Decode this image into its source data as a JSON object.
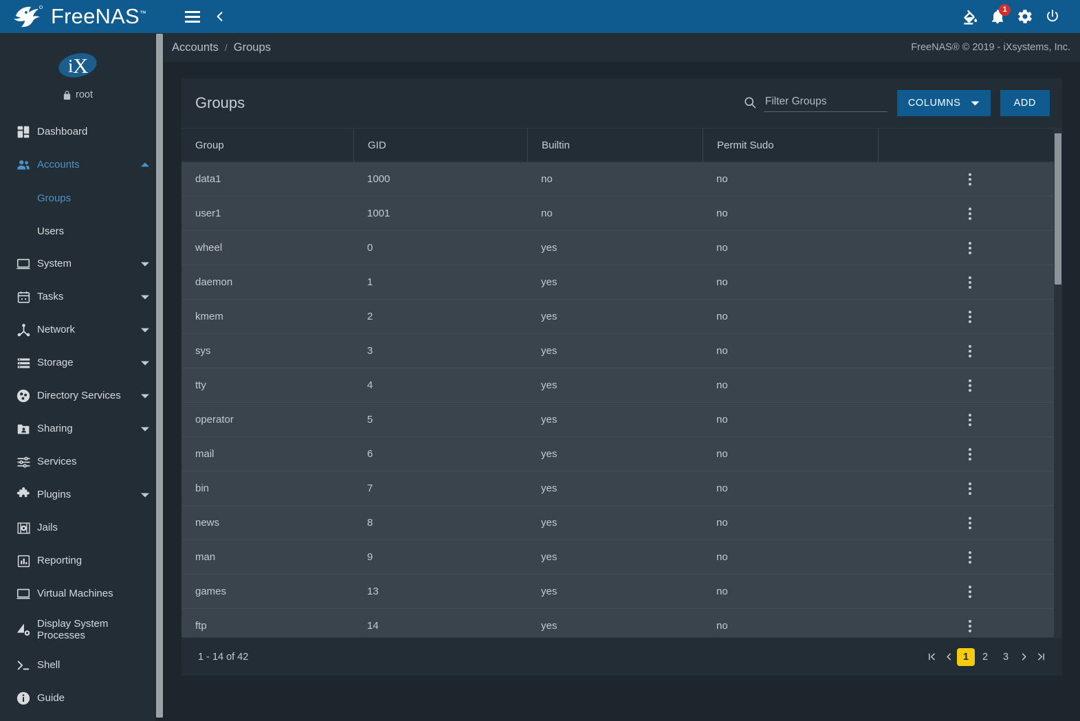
{
  "topbar": {
    "brand": "FreeNAS",
    "brand_tm": "™",
    "menu_icon": "hamburger-icon",
    "back_icon": "chevron-left-icon",
    "theme_icon": "paint-bucket-icon",
    "notifications_icon": "bell-icon",
    "notifications_count": "1",
    "settings_icon": "gear-icon",
    "power_icon": "power-icon"
  },
  "sidebar": {
    "logo": "ix-logo",
    "logo_text": "iX",
    "user": "root",
    "user_icon": "lock-icon",
    "items": [
      {
        "label": "Dashboard",
        "icon": "dashboard-icon",
        "expandable": false,
        "active": false
      },
      {
        "label": "Accounts",
        "icon": "accounts-icon",
        "expandable": true,
        "expanded": true,
        "active": true
      },
      {
        "label": "System",
        "icon": "system-icon",
        "expandable": true,
        "active": false
      },
      {
        "label": "Tasks",
        "icon": "tasks-icon",
        "expandable": true,
        "active": false
      },
      {
        "label": "Network",
        "icon": "network-icon",
        "expandable": true,
        "active": false
      },
      {
        "label": "Storage",
        "icon": "storage-icon",
        "expandable": true,
        "active": false
      },
      {
        "label": "Directory Services",
        "icon": "directory-services-icon",
        "expandable": true,
        "active": false
      },
      {
        "label": "Sharing",
        "icon": "sharing-icon",
        "expandable": true,
        "active": false
      },
      {
        "label": "Services",
        "icon": "services-icon",
        "expandable": false,
        "active": false
      },
      {
        "label": "Plugins",
        "icon": "plugins-icon",
        "expandable": true,
        "active": false
      },
      {
        "label": "Jails",
        "icon": "jails-icon",
        "expandable": false,
        "active": false
      },
      {
        "label": "Reporting",
        "icon": "reporting-icon",
        "expandable": false,
        "active": false
      },
      {
        "label": "Virtual Machines",
        "icon": "virtual-machines-icon",
        "expandable": false,
        "active": false
      },
      {
        "label": "Display System Processes",
        "icon": "display-system-processes-icon",
        "expandable": false,
        "active": false
      },
      {
        "label": "Shell",
        "icon": "shell-icon",
        "expandable": false,
        "active": false
      },
      {
        "label": "Guide",
        "icon": "guide-icon",
        "expandable": false,
        "active": false
      }
    ],
    "subitems": [
      {
        "label": "Groups",
        "active": true
      },
      {
        "label": "Users",
        "active": false
      }
    ]
  },
  "breadcrumb": {
    "parent": "Accounts",
    "separator": "/",
    "current": "Groups",
    "copyright": "FreeNAS® © 2019 - iXsystems, Inc."
  },
  "card": {
    "title": "Groups",
    "search_placeholder": "Filter Groups",
    "search_value": "",
    "search_icon": "search-icon",
    "columns_button": "COLUMNS",
    "columns_caret_icon": "chevron-down-icon",
    "add_button": "ADD",
    "actions_icon": "kebab-menu-icon"
  },
  "table": {
    "headers": [
      "Group",
      "GID",
      "Builtin",
      "Permit Sudo",
      ""
    ],
    "rows": [
      {
        "group": "data1",
        "gid": "1000",
        "builtin": "no",
        "permit_sudo": "no"
      },
      {
        "group": "user1",
        "gid": "1001",
        "builtin": "no",
        "permit_sudo": "no"
      },
      {
        "group": "wheel",
        "gid": "0",
        "builtin": "yes",
        "permit_sudo": "no"
      },
      {
        "group": "daemon",
        "gid": "1",
        "builtin": "yes",
        "permit_sudo": "no"
      },
      {
        "group": "kmem",
        "gid": "2",
        "builtin": "yes",
        "permit_sudo": "no"
      },
      {
        "group": "sys",
        "gid": "3",
        "builtin": "yes",
        "permit_sudo": "no"
      },
      {
        "group": "tty",
        "gid": "4",
        "builtin": "yes",
        "permit_sudo": "no"
      },
      {
        "group": "operator",
        "gid": "5",
        "builtin": "yes",
        "permit_sudo": "no"
      },
      {
        "group": "mail",
        "gid": "6",
        "builtin": "yes",
        "permit_sudo": "no"
      },
      {
        "group": "bin",
        "gid": "7",
        "builtin": "yes",
        "permit_sudo": "no"
      },
      {
        "group": "news",
        "gid": "8",
        "builtin": "yes",
        "permit_sudo": "no"
      },
      {
        "group": "man",
        "gid": "9",
        "builtin": "yes",
        "permit_sudo": "no"
      },
      {
        "group": "games",
        "gid": "13",
        "builtin": "yes",
        "permit_sudo": "no"
      },
      {
        "group": "ftp",
        "gid": "14",
        "builtin": "yes",
        "permit_sudo": "no"
      }
    ]
  },
  "footer": {
    "range_text": "1 - 14 of 42",
    "first_icon": "first-page-icon",
    "prev_icon": "previous-page-icon",
    "pages": [
      "1",
      "2",
      "3"
    ],
    "current_page": "1",
    "next_icon": "next-page-icon",
    "last_icon": "last-page-icon"
  },
  "colors": {
    "brand_blue": "#0f5b8f",
    "page_bg": "#1d252d",
    "panel_bg": "#222d36",
    "row_bg": "#3a444d",
    "accent_active": "#4b93c9",
    "pager_current": "#f5cb0e",
    "badge_red": "#d32f2f"
  }
}
